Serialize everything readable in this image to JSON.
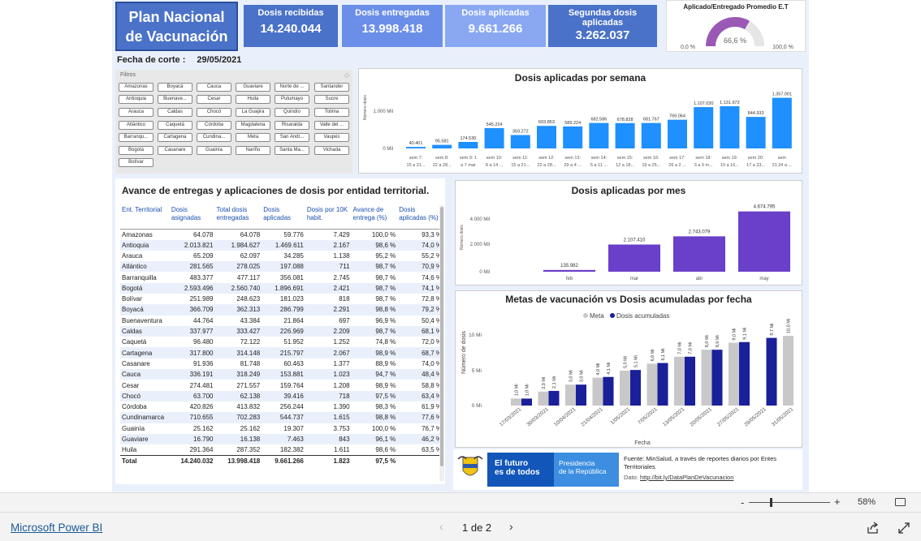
{
  "header": {
    "title_line1": "Plan Nacional",
    "title_line2": "de Vacunación",
    "cards": [
      {
        "label": "Dosis recibidas",
        "value": "14.240.044",
        "color": "#4a72c8"
      },
      {
        "label": "Dosis entregadas",
        "value": "13.998.418",
        "color": "#6b8fe8"
      },
      {
        "label": "Dosis aplicadas",
        "value": "9.661.266",
        "color": "#8aa8f2"
      },
      {
        "label": "Segundas dosis aplicadas",
        "value": "3.262.037",
        "color": "#4a72c8"
      }
    ],
    "gauge": {
      "title": "Aplicado/Entregado Promedio E.T",
      "value_label": "66,6 %",
      "min_label": "0,0 %",
      "max_label": "100,0 %",
      "fraction": 0.666,
      "fill_color": "#9b59b6",
      "track_color": "#e6e6e6"
    }
  },
  "fecha": {
    "label": "Fecha de corte :",
    "value": "29/05/2021"
  },
  "filters": {
    "title": "Filtros",
    "items": [
      "Amazonas",
      "Boyacá",
      "Cauca",
      "Guaviare",
      "Norte de ...",
      "Santander",
      "Antioquia",
      "Buenave...",
      "Cesar",
      "Huila",
      "Putumayo",
      "Sucre",
      "Arauca",
      "Caldas",
      "Chocó",
      "La Guajira",
      "Quindío",
      "Tolima",
      "Atlántico",
      "Caquetá",
      "Córdoba",
      "Magdalena",
      "Risaralda",
      "Valle del ...",
      "Barranqu...",
      "Cartagena",
      "Cundina...",
      "Meta",
      "San Andr...",
      "Vaupés",
      "Bogotá",
      "Casanare",
      "Guainía",
      "Nariño",
      "Santa Ma...",
      "Vichada",
      "Bolívar"
    ]
  },
  "weekly": {
    "title": "Dosis aplicadas por semana",
    "ylabel": "Número dosis",
    "ticks": [
      "1.000 Mil",
      "0 Mil"
    ],
    "bar_color": "#1e90ff",
    "bars": [
      {
        "value_label": "40.401",
        "v": 40401,
        "l1": "sem 7:",
        "l2": "15 a 21..."
      },
      {
        "value_label": "95.581",
        "v": 95581,
        "l1": "sem 8:",
        "l2": "22 a 28..."
      },
      {
        "value_label": "174.530",
        "v": 174530,
        "l1": "sem 9: 1",
        "l2": "a 7 mar"
      },
      {
        "value_label": "545.224",
        "v": 545224,
        "l1": "sem 10:",
        "l2": "8 a 14 ..."
      },
      {
        "value_label": "359.272",
        "v": 359272,
        "l1": "sem 11:",
        "l2": "15 a 21..."
      },
      {
        "value_label": "603.853",
        "v": 603853,
        "l1": "sem 12:",
        "l2": "22 a 28..."
      },
      {
        "value_label": "589.224",
        "v": 589224,
        "l1": "sem 13:",
        "l2": "29 a 4 ..."
      },
      {
        "value_label": "682.586",
        "v": 682586,
        "l1": "sem 14:",
        "l2": "5 a 11 ..."
      },
      {
        "value_label": "678.828",
        "v": 678828,
        "l1": "sem 15:",
        "l2": "12 a 18..."
      },
      {
        "value_label": "681.767",
        "v": 681767,
        "l1": "sem 16:",
        "l2": "19 a 25..."
      },
      {
        "value_label": "769.064",
        "v": 769064,
        "l1": "sem 17:",
        "l2": "26 a 2 ..."
      },
      {
        "value_label": "1.107.030",
        "v": 1107030,
        "l1": "sem 18:",
        "l2": "3 a 9 m..."
      },
      {
        "value_label": "1.131.972",
        "v": 1131972,
        "l1": "sem 19:",
        "l2": "10 a 16..."
      },
      {
        "value_label": "844.933",
        "v": 844933,
        "l1": "sem 20:",
        "l2": "17 a 23..."
      },
      {
        "value_label": "1.357.001",
        "v": 1357001,
        "l1": "sem",
        "l2": "21:24 a ..."
      }
    ]
  },
  "monthly": {
    "title": "Dosis aplicadas por mes",
    "ylabel": "Número dosis",
    "ticks": [
      "4.000 Mil",
      "2.000 Mil",
      "0 Mil"
    ],
    "bar_color": "#6a3fc9",
    "bars": [
      {
        "label": "feb",
        "value_label": "135.982",
        "v": 135982
      },
      {
        "label": "mar",
        "value_label": "2.107.410",
        "v": 2107410
      },
      {
        "label": "abr",
        "value_label": "2.743.079",
        "v": 2743079
      },
      {
        "label": "may",
        "value_label": "4.674.795",
        "v": 4674795
      }
    ]
  },
  "metas": {
    "title": "Metas de vacunación vs Dosis acumuladas por fecha",
    "legend": [
      {
        "label": "Meta",
        "color": "#c8c8c8"
      },
      {
        "label": "Dosis acumuladas",
        "color": "#1a1f9a"
      }
    ],
    "ylabel": "Número de dosis",
    "xlabel": "Fecha",
    "ticks": [
      "10 Mi",
      "5 Mi",
      "0 Mi"
    ],
    "groups": [
      {
        "date": "17/03/2021",
        "meta": 1.0,
        "meta_label": "1,0 Mi",
        "dosis": 1.0,
        "dosis_label": "1,0 Mi"
      },
      {
        "date": "30/03/2021",
        "meta": 2.0,
        "meta_label": "2,0 Mi",
        "dosis": 2.1,
        "dosis_label": "2,1 Mi"
      },
      {
        "date": "10/04/2021",
        "meta": 3.0,
        "meta_label": "3,0 Mi",
        "dosis": 3.0,
        "dosis_label": "3,0 Mi"
      },
      {
        "date": "21/04/2021",
        "meta": 4.0,
        "meta_label": "4,0 Mi",
        "dosis": 4.1,
        "dosis_label": "4,1 Mi"
      },
      {
        "date": "1/05/2021",
        "meta": 5.0,
        "meta_label": "5,0 Mi",
        "dosis": 5.1,
        "dosis_label": "5,1 Mi"
      },
      {
        "date": "7/05/2021",
        "meta": 6.0,
        "meta_label": "6,0 Mi",
        "dosis": 6.1,
        "dosis_label": "6,1 Mi"
      },
      {
        "date": "13/05/2021",
        "meta": 7.0,
        "meta_label": "7,0 Mi",
        "dosis": 7.0,
        "dosis_label": "7,0 Mi"
      },
      {
        "date": "20/05/2021",
        "meta": 8.0,
        "meta_label": "8,0 Mi",
        "dosis": 8.0,
        "dosis_label": "8,0 Mi"
      },
      {
        "date": "27/05/2021",
        "meta": 9.0,
        "meta_label": "9,0 Mi",
        "dosis": 9.1,
        "dosis_label": "9,1 Mi"
      },
      {
        "date": "29/05/2021",
        "meta": null,
        "meta_label": "",
        "dosis": 9.7,
        "dosis_label": "9,7 Mi"
      },
      {
        "date": "31/05/2021",
        "meta": 10.0,
        "meta_label": "10,0 Mi",
        "dosis": null,
        "dosis_label": ""
      }
    ]
  },
  "table": {
    "title": "Avance de  entregas y aplicaciones de dosis por entidad territorial.",
    "headers": [
      "Ent. Territorial",
      "Dosis asignadas",
      "Total dosis entregadas",
      "Dosis aplicadas",
      "Dosis por 10K habit.",
      "Avance de entrega (%)",
      "Dosis aplicadas (%)"
    ],
    "rows": [
      [
        "Amazonas",
        "64.078",
        "64.078",
        "59.776",
        "7.429",
        "100,0 %",
        "93,3 %"
      ],
      [
        "Antioquia",
        "2.013.821",
        "1.984.627",
        "1.469.611",
        "2.167",
        "98,6 %",
        "74,0 %"
      ],
      [
        "Arauca",
        "65.209",
        "62.097",
        "34.285",
        "1.138",
        "95,2 %",
        "55,2 %"
      ],
      [
        "Atlántico",
        "281.565",
        "278.025",
        "197.088",
        "711",
        "98,7 %",
        "70,9 %"
      ],
      [
        "Barranquilla",
        "483.377",
        "477.117",
        "356.081",
        "2.745",
        "98,7 %",
        "74,6 %"
      ],
      [
        "Bogotá",
        "2.593.496",
        "2.560.740",
        "1.896.691",
        "2.421",
        "98,7 %",
        "74,1 %"
      ],
      [
        "Bolívar",
        "251.989",
        "248.623",
        "181.023",
        "818",
        "98,7 %",
        "72,8 %"
      ],
      [
        "Boyacá",
        "366.709",
        "362.313",
        "286.799",
        "2.291",
        "98,8 %",
        "79,2 %"
      ],
      [
        "Buenaventura",
        "44.764",
        "43.384",
        "21.864",
        "697",
        "96,9 %",
        "50,4 %"
      ],
      [
        "Caldas",
        "337.977",
        "333.427",
        "226.969",
        "2.209",
        "98,7 %",
        "68,1 %"
      ],
      [
        "Caquetá",
        "96.480",
        "72.122",
        "51.952",
        "1.252",
        "74,8 %",
        "72,0 %"
      ],
      [
        "Cartagena",
        "317.800",
        "314.148",
        "215.797",
        "2.067",
        "98,9 %",
        "68,7 %"
      ],
      [
        "Casanare",
        "91.936",
        "81.748",
        "60.463",
        "1.377",
        "88,9 %",
        "74,0 %"
      ],
      [
        "Cauca",
        "336.191",
        "318.249",
        "153.881",
        "1.023",
        "94,7 %",
        "48,4 %"
      ],
      [
        "Cesar",
        "274.481",
        "271.557",
        "159.764",
        "1.208",
        "98,9 %",
        "58,8 %"
      ],
      [
        "Chocó",
        "63.700",
        "62.138",
        "39.416",
        "718",
        "97,5 %",
        "63,4 %"
      ],
      [
        "Córdoba",
        "420.826",
        "413.832",
        "256.244",
        "1.390",
        "98,3 %",
        "61,9 %"
      ],
      [
        "Cundinamarca",
        "710.655",
        "702.283",
        "544.737",
        "1.615",
        "98,8 %",
        "77,6 %"
      ],
      [
        "Guainía",
        "25.162",
        "25.162",
        "19.307",
        "3.753",
        "100,0 %",
        "76,7 %"
      ],
      [
        "Guaviare",
        "16.790",
        "16.138",
        "7.463",
        "843",
        "96,1 %",
        "46,2 %"
      ],
      [
        "Huila",
        "291.364",
        "287.352",
        "182.382",
        "1.611",
        "98,6 %",
        "63,5 %"
      ]
    ],
    "total": [
      "Total",
      "14.240.032",
      "13.998.418",
      "9.661.266",
      "1.823",
      "97,5 %",
      ""
    ]
  },
  "footer": {
    "slogan_line1": "El futuro",
    "slogan_line2": "es de todos",
    "gov_line1": "Presidencia",
    "gov_line2": "de la República",
    "source": "Fuente: MinSalud, a través de reportes diarios por Entes Territoriales",
    "data_prefix": "Dato:",
    "data_link": "http://bit.ly/DataPlanDeVacunacion"
  },
  "statusbar": {
    "minus": "-",
    "plus": "+",
    "zoom": "58%",
    "zoom_level": 0.58
  },
  "bottombar": {
    "brand": "Microsoft Power BI",
    "page": "1 de 2"
  }
}
